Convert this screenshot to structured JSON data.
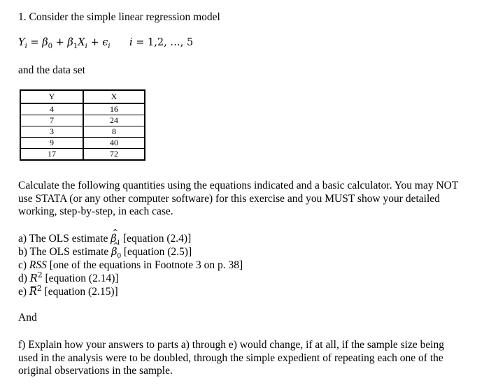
{
  "question": {
    "heading": "1. Consider the simple linear regression model",
    "model": {
      "lhs": "Y",
      "lhs_sub": "i",
      "eq": " = ",
      "b0": "β",
      "b0_sub": "0",
      "plus1": " + ",
      "b1": "β",
      "b1_sub": "1",
      "x": "X",
      "x_sub": "i",
      "plus2": " + ",
      "eps": "ϵ",
      "eps_sub": "i",
      "index": "i",
      "index_eq": " = ",
      "index_range": "1,2, …, 5"
    },
    "data_intro": "and the data set",
    "table": {
      "headers": [
        "Y",
        "X"
      ],
      "rows": [
        [
          "4",
          "16"
        ],
        [
          "7",
          "24"
        ],
        [
          "3",
          "8"
        ],
        [
          "9",
          "40"
        ],
        [
          "17",
          "72"
        ]
      ]
    },
    "instructions": "Calculate the following quantities using the equations indicated and a basic calculator. You may NOT use STATA (or any other computer software) for this exercise and you MUST show your detailed working, step-by-step, in each case.",
    "parts": [
      {
        "prefix": "a) The OLS estimate ",
        "symbol": "β",
        "sub": "1",
        "suffix": " [equation (2.4)]"
      },
      {
        "prefix": "b) The OLS estimate ",
        "symbol": "β",
        "sub": "0",
        "suffix": " [equation (2.5)]"
      },
      {
        "prefix": "c) ",
        "symbol": "RSS",
        "suffix": " [one of the equations in Footnote 3 on p. 38]"
      },
      {
        "prefix": "d) ",
        "symbol": "R",
        "sup": "2",
        "suffix": " [equation (2.14)]"
      },
      {
        "prefix": "e) ",
        "symbol": "R",
        "sup": "2",
        "suffix": " [equation (2.15)]"
      }
    ],
    "and_label": "And",
    "part_f": "f) Explain how your answers to parts a) through e) would change, if at all, if the sample size being used in the analysis were to be doubled, through the simple expedient of repeating each one of the original observations in the sample."
  }
}
